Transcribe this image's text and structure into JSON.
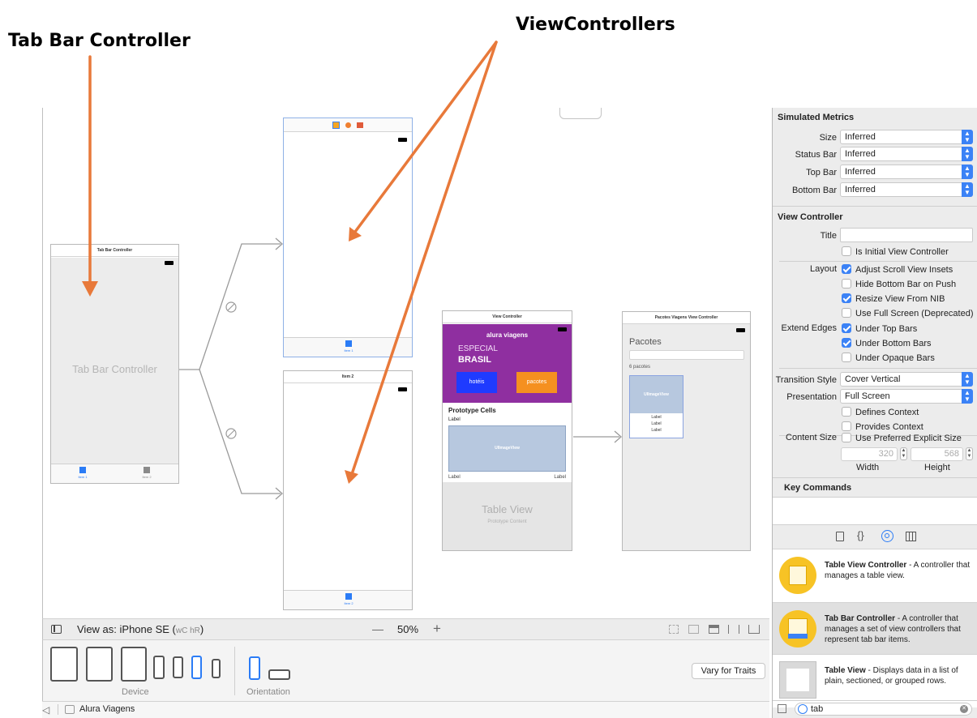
{
  "annotations": {
    "tab_bar_controller": "Tab Bar Controller",
    "view_controllers": "ViewControllers"
  },
  "colors": {
    "arrow": "#e8793a",
    "accent": "#3b82f6",
    "header_purple": "#8f2fa0",
    "button_blue": "#1f3bff",
    "button_orange": "#f59020",
    "image_placeholder": "#b7c8df",
    "library_icon": "#f7c325"
  },
  "canvas": {
    "tab_bar_scene": {
      "title": "Tab Bar Controller",
      "placeholder": "Tab Bar Controller",
      "tabs": [
        "Item 1",
        "Item 2"
      ]
    },
    "item1_scene": {
      "tab": "Item 1"
    },
    "item2_scene": {
      "title": "Item 2",
      "tab": "Item 2"
    },
    "view_controller_scene": {
      "title": "View Controller",
      "app_name": "alura viagens",
      "especial": "ESPECIAL",
      "brasil": "BRASIL",
      "btn_hoteis": "hotéis",
      "btn_pacotes": "pacotes",
      "prototype_cells": "Prototype Cells",
      "label": "Label",
      "image_view": "UIImageView",
      "label_left": "Label",
      "label_right": "Label",
      "table_view": "Table View",
      "prototype_content": "Prototype Content"
    },
    "pacotes_scene": {
      "title": "Pacotes Viagens View Controller",
      "heading": "Pacotes",
      "count": "6 pacotes",
      "image_view": "UIImageView",
      "labels": [
        "Label",
        "Label",
        "Label"
      ]
    }
  },
  "view_as": {
    "label": "View as: iPhone SE (",
    "size_class": "wC hR",
    "close": ")",
    "zoom_out": "—",
    "zoom": "50%",
    "zoom_in": "+"
  },
  "device_bar": {
    "device_label": "Device",
    "orientation_label": "Orientation",
    "vary_button": "Vary for Traits"
  },
  "status_bar": {
    "project": "Alura Viagens"
  },
  "inspector": {
    "simulated_metrics": {
      "header": "Simulated Metrics",
      "rows": [
        {
          "label": "Size",
          "value": "Inferred"
        },
        {
          "label": "Status Bar",
          "value": "Inferred"
        },
        {
          "label": "Top Bar",
          "value": "Inferred"
        },
        {
          "label": "Bottom Bar",
          "value": "Inferred"
        }
      ]
    },
    "view_controller": {
      "header": "View Controller",
      "title_label": "Title",
      "title_value": "",
      "is_initial": "Is Initial View Controller",
      "layout_label": "Layout",
      "adjust_scroll": "Adjust Scroll View Insets",
      "hide_bottom": "Hide Bottom Bar on Push",
      "resize_nib": "Resize View From NIB",
      "full_screen": "Use Full Screen (Deprecated)",
      "extend_edges_label": "Extend Edges",
      "under_top": "Under Top Bars",
      "under_bottom": "Under Bottom Bars",
      "under_opaque": "Under Opaque Bars",
      "transition_label": "Transition Style",
      "transition_value": "Cover Vertical",
      "presentation_label": "Presentation",
      "presentation_value": "Full Screen",
      "defines_context": "Defines Context",
      "provides_context": "Provides Context",
      "content_size_label": "Content Size",
      "preferred_size": "Use Preferred Explicit Size",
      "width_value": "320",
      "height_value": "568",
      "width_label": "Width",
      "height_label": "Height"
    },
    "key_commands": {
      "header": "Key Commands"
    },
    "library": [
      {
        "name": "Table View Controller",
        "desc": " - A controller that manages a table view."
      },
      {
        "name": "Tab Bar Controller",
        "desc": " - A controller that manages a set of view controllers that represent tab bar items."
      },
      {
        "name": "Table View",
        "desc": " - Displays data in a list of plain, sectioned, or grouped rows."
      }
    ],
    "filter_value": "tab"
  }
}
